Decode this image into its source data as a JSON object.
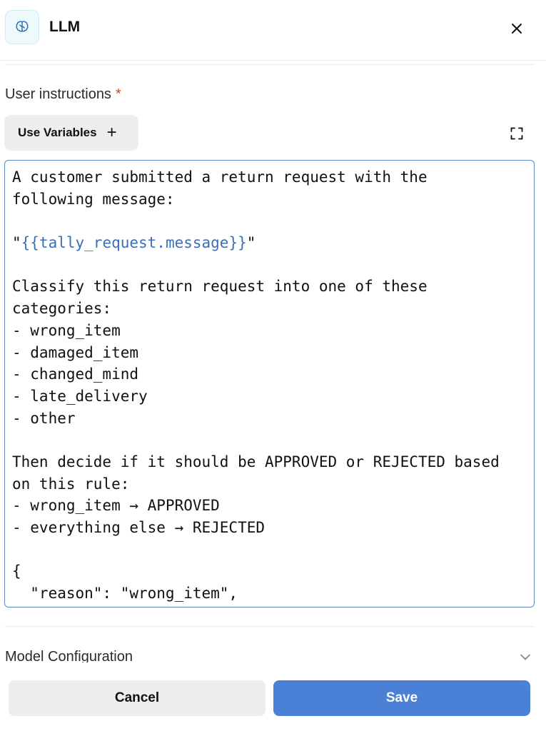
{
  "header": {
    "icon": "brain-icon",
    "title": "LLM",
    "close_icon": "close-icon"
  },
  "instructions": {
    "label": "User instructions",
    "required_mark": "*",
    "use_variables_label": "Use Variables",
    "use_variables_icon": "plus-icon",
    "expand_icon": "expand-icon",
    "lines": [
      "A customer submitted a return request with the",
      "following message:",
      "",
      "\"{{tally_request.message}}\"",
      "",
      "Classify this return request into one of these",
      "categories:",
      "- wrong_item",
      "- damaged_item",
      "- changed_mind",
      "- late_delivery",
      "- other",
      "",
      "Then decide if it should be APPROVED or REJECTED based",
      "on this rule:",
      "- wrong_item → APPROVED",
      "- everything else → REJECTED",
      "",
      "{",
      "  \"reason\": \"wrong_item\","
    ]
  },
  "model_config": {
    "label": "Model Configuration",
    "chevron_icon": "chevron-down-icon"
  },
  "footer": {
    "cancel_label": "Cancel",
    "save_label": "Save"
  },
  "colors": {
    "accent": "#4a80d6",
    "variable_text": "#3d6fb4",
    "editor_border": "#5a88c8",
    "required": "#d0452c",
    "icon_bg": "#edfafb"
  }
}
